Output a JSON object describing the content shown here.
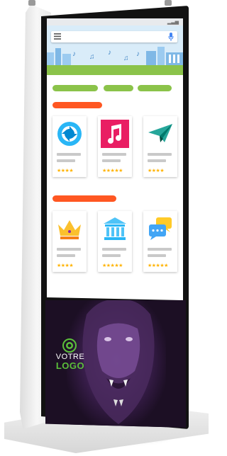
{
  "kiosk": {
    "poster": {
      "logo_top": "VOTRE",
      "logo_bottom": "LOGO",
      "logo_color": "#5bbf3a"
    }
  },
  "screen": {
    "accent_color": "#ff5722",
    "chip_color": "#8bc34a",
    "star_color": "#ffb300",
    "top_icons": [
      "menu-icon",
      "mic-icon"
    ],
    "sections": [
      {
        "cards": [
          {
            "icon": "camera-aperture-icon",
            "rating": 4,
            "stars_text": "★★★★"
          },
          {
            "icon": "music-note-icon",
            "rating": 5,
            "stars_text": "★★★★★"
          },
          {
            "icon": "paper-plane-icon",
            "rating": 4,
            "stars_text": "★★★★"
          }
        ]
      },
      {
        "cards": [
          {
            "icon": "crown-icon",
            "rating": 4,
            "stars_text": "★★★★"
          },
          {
            "icon": "museum-icon",
            "rating": 5,
            "stars_text": "★★★★★"
          },
          {
            "icon": "chat-bubbles-icon",
            "rating": 5,
            "stars_text": "★★★★★"
          }
        ]
      }
    ]
  }
}
